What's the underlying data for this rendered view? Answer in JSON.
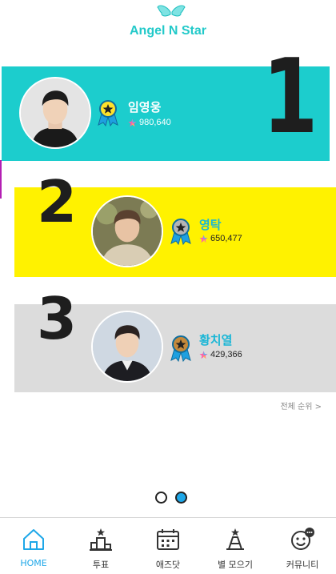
{
  "app": {
    "title": "Angel N Star"
  },
  "rankings": [
    {
      "rank": "1",
      "name": "임영웅",
      "votes": "980,640",
      "medal": "gold-medal"
    },
    {
      "rank": "2",
      "name": "영탁",
      "votes": "650,477",
      "medal": "silver-medal"
    },
    {
      "rank": "3",
      "name": "황치열",
      "votes": "429,366",
      "medal": "bronze-medal"
    }
  ],
  "full_ranking_link": "전체 순위 >",
  "pager": {
    "pages": 2,
    "current": 2
  },
  "bottom_nav": [
    {
      "label": "HOME",
      "icon": "home-icon",
      "active": true
    },
    {
      "label": "투표",
      "icon": "vote-icon",
      "active": false
    },
    {
      "label": "애즈닷",
      "icon": "calendar-icon",
      "active": false
    },
    {
      "label": "별 모으기",
      "icon": "collect-stars-icon",
      "active": false
    },
    {
      "label": "커뮤니티",
      "icon": "community-icon",
      "active": false
    }
  ],
  "colors": {
    "brand": "#22c9c9",
    "rank1_bg": "#1ccdcd",
    "rank2_bg": "#fff200",
    "rank3_bg": "#dcdcdc",
    "accent": "#1ea7e8"
  }
}
